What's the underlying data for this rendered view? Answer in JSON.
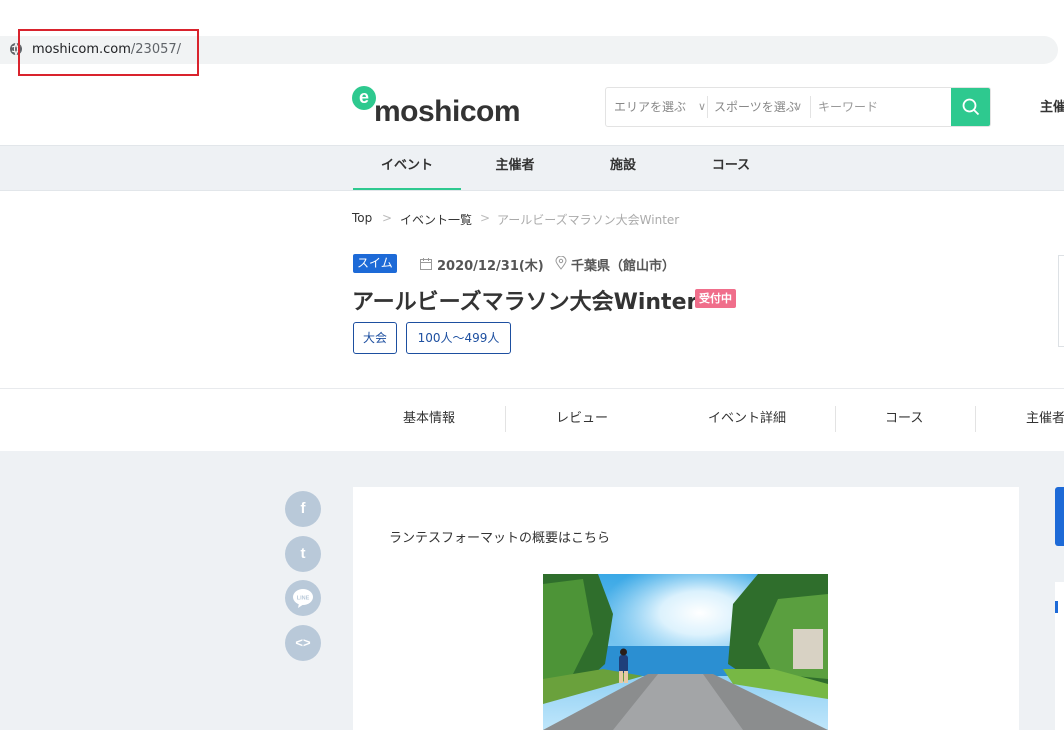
{
  "browser": {
    "url_domain": "moshicom.com",
    "url_path": "/23057/"
  },
  "header": {
    "logo_e": "e",
    "logo_text": "moshicom",
    "area_select": "エリアを選ぶ",
    "sport_select": "スポーツを選ぶ",
    "keyword_placeholder": "キーワード",
    "right_link": "主催"
  },
  "nav": {
    "items": [
      {
        "label": "イベント"
      },
      {
        "label": "主催者"
      },
      {
        "label": "施設"
      },
      {
        "label": "コース"
      }
    ]
  },
  "breadcrumb": [
    "Top",
    "イベント一覧",
    "アールビーズマラソン大会Winter"
  ],
  "breadcrumb_sep": ">",
  "event": {
    "sport_tag": "スイム",
    "date": "2020/12/31(木)",
    "location": "千葉県（館山市）",
    "title": "アールビーズマラソン大会Winter",
    "status": "受付中",
    "chips": [
      "大会",
      "100人〜499人"
    ]
  },
  "subtabs": [
    "基本情報",
    "レビュー",
    "イベント詳細",
    "コース",
    "主催者"
  ],
  "share": {
    "facebook": "f",
    "twitter": "t",
    "line": "LINE",
    "embed": "<>"
  },
  "content": {
    "intro": "ランテスフォーマットの概要はこちら"
  },
  "colors": {
    "accent": "#2ec98f",
    "tag_blue": "#1d6ad7",
    "status_pink": "#f06e8b",
    "highlight_red": "#d9232d"
  }
}
